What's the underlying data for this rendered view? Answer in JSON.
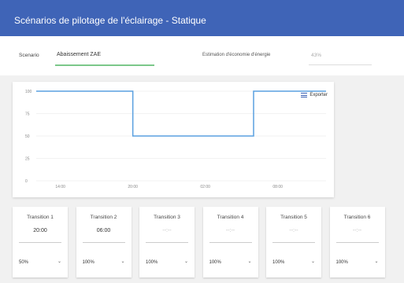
{
  "header": {
    "title": "Scénarios de pilotage de l'éclairage - Statique"
  },
  "scenario": {
    "label": "Scenario",
    "value": "Abaissement ZAE",
    "eco_label": "Estimation d'économie d'énergie",
    "eco_value": "43%"
  },
  "chart": {
    "export_label": "Exporter",
    "menu_icon": "menu-icon"
  },
  "chart_data": {
    "type": "line",
    "title": "",
    "xlabel": "",
    "ylabel": "",
    "ylim": [
      0,
      100
    ],
    "yticks": [
      "100",
      "75",
      "50",
      "25",
      "0"
    ],
    "xticks": [
      "14:00",
      "20:00",
      "02:00",
      "08:00"
    ],
    "grid": true,
    "series": [
      {
        "color": "#5aa0e0",
        "points": [
          [
            "12:00",
            100
          ],
          [
            "20:00",
            100
          ],
          [
            "20:00",
            50
          ],
          [
            "06:00",
            50
          ],
          [
            "06:00",
            100
          ],
          [
            "12:00",
            100
          ]
        ]
      }
    ]
  },
  "transitions": [
    {
      "title": "Transition 1",
      "time": "20:00",
      "level": "50%"
    },
    {
      "title": "Transition 2",
      "time": "06:00",
      "level": "100%"
    },
    {
      "title": "Transition 3",
      "time": "--:--",
      "level": "100%"
    },
    {
      "title": "Transition 4",
      "time": "--:--",
      "level": "100%"
    },
    {
      "title": "Transition 5",
      "time": "--:--",
      "level": "100%"
    },
    {
      "title": "Transition 6",
      "time": "--:--",
      "level": "100%"
    }
  ]
}
